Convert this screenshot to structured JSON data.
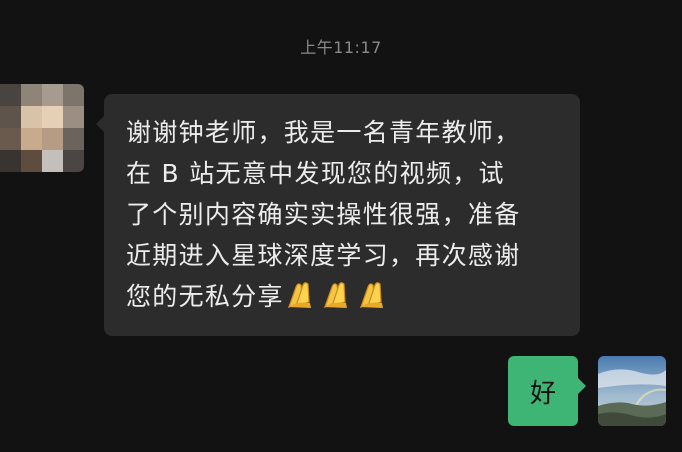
{
  "header": {
    "timestamp": "上午11:17"
  },
  "messages": [
    {
      "direction": "incoming",
      "lines": [
        "谢谢钟老师，我是一名青年教师，",
        "在 B 站无意中发现您的视频，试",
        "了个别内容确实实操性很强，准备",
        "近期进入星球深度学习，再次感谢",
        "您的无私分享"
      ],
      "trailing_emoji": "folded-hands-emoji x3"
    },
    {
      "direction": "outgoing",
      "text": "好"
    }
  ],
  "colors": {
    "background": "#121212",
    "incoming_bubble": "#2c2c2c",
    "outgoing_bubble": "#3eb575",
    "timestamp_text": "#8a8a8a",
    "message_text": "#ececec"
  }
}
